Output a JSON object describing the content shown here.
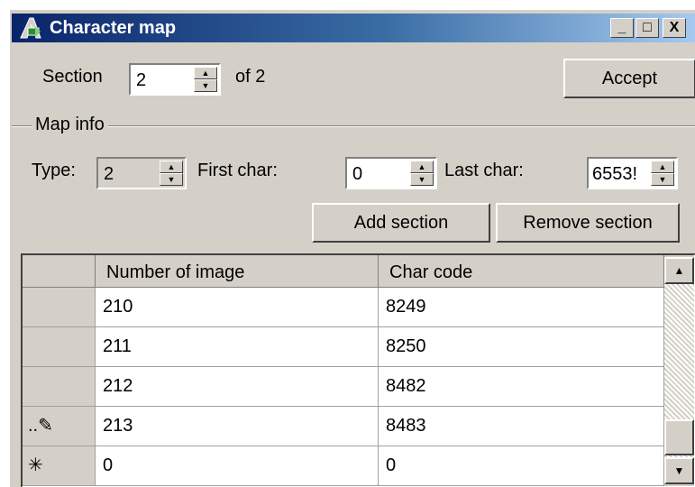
{
  "window": {
    "title": "Character map",
    "controls": {
      "minimize": "_",
      "maximize": "□",
      "close": "X"
    }
  },
  "section": {
    "label": "Section",
    "value": "2",
    "of_label": "of 2"
  },
  "accept_label": "Accept",
  "map_info": {
    "group_label": "Map info",
    "type_label": "Type:",
    "type_value": "2",
    "first_char_label": "First char:",
    "first_char_value": "0",
    "last_char_label": "Last char:",
    "last_char_value": "6553!",
    "add_section_label": "Add section",
    "remove_section_label": "Remove section"
  },
  "table": {
    "columns": [
      "Number of image",
      "Char code"
    ],
    "rows": [
      {
        "marker": "",
        "image": "210",
        "code": "8249"
      },
      {
        "marker": "",
        "image": "211",
        "code": "8250"
      },
      {
        "marker": "",
        "image": "212",
        "code": "8482"
      },
      {
        "marker": "..✎",
        "image": "213",
        "code": "8483"
      },
      {
        "marker": "✳",
        "image": "0",
        "code": "0"
      }
    ]
  },
  "icons": {
    "title": "app-icon",
    "spin_up": "▲",
    "spin_down": "▼",
    "scroll_up": "▲",
    "scroll_down": "▼"
  },
  "colors": {
    "title_start": "#0a246a",
    "title_end": "#a6caf0",
    "face": "#d4d0c8"
  }
}
